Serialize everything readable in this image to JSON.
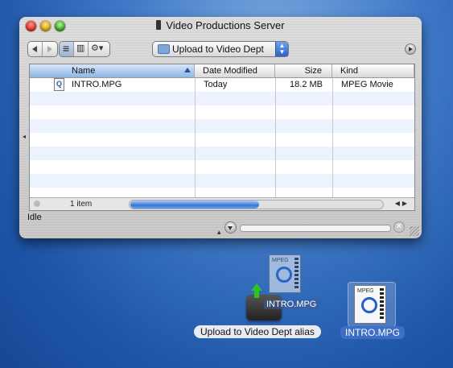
{
  "window": {
    "title": "Video Productions Server",
    "location_popup": "Upload to Video Dept",
    "status": "Idle"
  },
  "columns": [
    {
      "label": "Name",
      "sorted": true
    },
    {
      "label": "Date Modified"
    },
    {
      "label": "Size"
    },
    {
      "label": "Kind"
    }
  ],
  "files": [
    {
      "name": "INTRO.MPG",
      "date": "Today",
      "size": "18.2 MB",
      "kind": "MPEG Movie",
      "icon": "mpeg-file-icon"
    }
  ],
  "item_count": "1 item",
  "desktop": {
    "alias_label": "Upload to Video Dept alias",
    "drag_label": "INTRO.MPG",
    "file_label": "INTRO.MPG",
    "mpeg_badge": "MPEG"
  },
  "colors": {
    "desktop": "#2f66b8",
    "selection_blue": "#3677d9"
  }
}
